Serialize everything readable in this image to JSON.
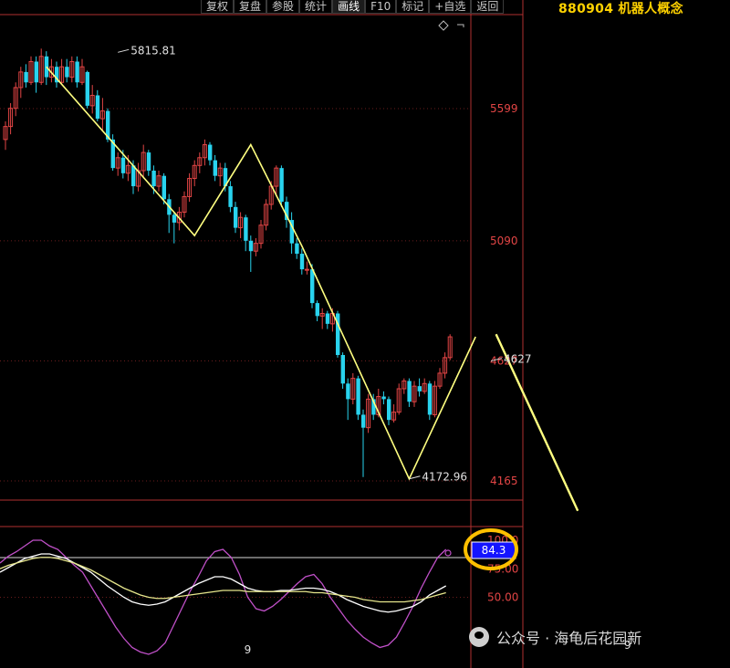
{
  "toolbar": {
    "items": [
      "复权",
      "复盘",
      "参股",
      "统计",
      "画线",
      "F10",
      "标记",
      "+自选",
      "返回"
    ],
    "active_index": 4
  },
  "instrument": {
    "title": "880904 机器人概念"
  },
  "watermark": {
    "text": "公众号 · 海龟后花园新"
  },
  "colors": {
    "background": "#000000",
    "up": "#e24545",
    "down": "#29d3ee",
    "trendline": "#ffff80",
    "axis": "#b03030",
    "price_label": "#e24545",
    "highlight": "#ffc000",
    "indicator_box": "#1414ff"
  },
  "chart_data": [
    {
      "type": "candlestick",
      "y_ticks": [
        5599,
        5090,
        4627,
        4165
      ],
      "ylim": [
        4065,
        5990
      ],
      "annotations": [
        {
          "text": "5815.81",
          "x": 22,
          "y": 5815.81
        },
        {
          "text": "4172.96",
          "x": 79,
          "y": 4172.96
        },
        {
          "text": "4627",
          "x": 95,
          "y": 4627
        }
      ],
      "last_price_marker": "4627",
      "candles": [
        [
          5480,
          5530,
          5440,
          5550
        ],
        [
          5530,
          5600,
          5500,
          5620
        ],
        [
          5600,
          5680,
          5570,
          5700
        ],
        [
          5680,
          5740,
          5640,
          5760
        ],
        [
          5740,
          5700,
          5680,
          5770
        ],
        [
          5700,
          5780,
          5690,
          5800
        ],
        [
          5780,
          5700,
          5660,
          5800
        ],
        [
          5700,
          5800,
          5690,
          5830
        ],
        [
          5800,
          5720,
          5690,
          5820
        ],
        [
          5720,
          5760,
          5700,
          5790
        ],
        [
          5760,
          5700,
          5680,
          5780
        ],
        [
          5700,
          5760,
          5690,
          5790
        ],
        [
          5760,
          5720,
          5700,
          5790
        ],
        [
          5720,
          5780,
          5700,
          5800
        ],
        [
          5780,
          5700,
          5680,
          5800
        ],
        [
          5700,
          5760,
          5690,
          5790
        ],
        [
          5740,
          5610,
          5600,
          5745
        ],
        [
          5610,
          5650,
          5580,
          5690
        ],
        [
          5650,
          5560,
          5550,
          5670
        ],
        [
          5560,
          5590,
          5510,
          5640
        ],
        [
          5590,
          5480,
          5470,
          5600
        ],
        [
          5480,
          5370,
          5360,
          5500
        ],
        [
          5370,
          5410,
          5340,
          5430
        ],
        [
          5410,
          5350,
          5330,
          5440
        ],
        [
          5350,
          5380,
          5320,
          5420
        ],
        [
          5380,
          5300,
          5270,
          5400
        ],
        [
          5300,
          5360,
          5280,
          5390
        ],
        [
          5360,
          5430,
          5330,
          5460
        ],
        [
          5430,
          5360,
          5340,
          5440
        ],
        [
          5360,
          5300,
          5270,
          5380
        ],
        [
          5300,
          5340,
          5280,
          5360
        ],
        [
          5340,
          5250,
          5230,
          5350
        ],
        [
          5250,
          5190,
          5120,
          5270
        ],
        [
          5190,
          5160,
          5080,
          5200
        ],
        [
          5160,
          5200,
          5130,
          5220
        ],
        [
          5200,
          5260,
          5180,
          5280
        ],
        [
          5260,
          5330,
          5240,
          5350
        ],
        [
          5330,
          5380,
          5300,
          5400
        ],
        [
          5380,
          5410,
          5350,
          5430
        ],
        [
          5410,
          5460,
          5380,
          5480
        ],
        [
          5460,
          5400,
          5380,
          5470
        ],
        [
          5400,
          5340,
          5320,
          5420
        ],
        [
          5340,
          5370,
          5300,
          5390
        ],
        [
          5370,
          5300,
          5280,
          5390
        ],
        [
          5300,
          5220,
          5200,
          5320
        ],
        [
          5220,
          5140,
          5120,
          5240
        ],
        [
          5140,
          5180,
          5100,
          5200
        ],
        [
          5180,
          5090,
          5050,
          5190
        ],
        [
          5090,
          5050,
          4970,
          5110
        ],
        [
          5050,
          5080,
          5030,
          5100
        ],
        [
          5080,
          5150,
          5060,
          5170
        ],
        [
          5150,
          5230,
          5130,
          5250
        ],
        [
          5230,
          5300,
          5210,
          5320
        ],
        [
          5300,
          5370,
          5260,
          5380
        ],
        [
          5370,
          5240,
          5220,
          5380
        ],
        [
          5240,
          5170,
          5140,
          5260
        ],
        [
          5170,
          5080,
          5040,
          5200
        ],
        [
          5080,
          5040,
          5020,
          5100
        ],
        [
          5040,
          4980,
          4960,
          5060
        ],
        [
          4980,
          4980,
          4960,
          5010
        ],
        [
          4980,
          4850,
          4830,
          5000
        ],
        [
          4850,
          4800,
          4780,
          4860
        ],
        [
          4800,
          4810,
          4750,
          4830
        ],
        [
          4810,
          4770,
          4750,
          4820
        ],
        [
          4770,
          4810,
          4740,
          4830
        ],
        [
          4810,
          4650,
          4640,
          4820
        ],
        [
          4650,
          4540,
          4520,
          4660
        ],
        [
          4540,
          4480,
          4400,
          4560
        ],
        [
          4480,
          4560,
          4460,
          4580
        ],
        [
          4560,
          4420,
          4400,
          4570
        ],
        [
          4420,
          4370,
          4180,
          4440
        ],
        [
          4370,
          4480,
          4350,
          4500
        ],
        [
          4480,
          4420,
          4400,
          4500
        ],
        [
          4420,
          4490,
          4410,
          4520
        ],
        [
          4490,
          4480,
          4460,
          4510
        ],
        [
          4480,
          4400,
          4380,
          4490
        ],
        [
          4400,
          4430,
          4390,
          4460
        ],
        [
          4430,
          4520,
          4420,
          4540
        ],
        [
          4520,
          4550,
          4500,
          4560
        ],
        [
          4550,
          4470,
          4450,
          4560
        ],
        [
          4470,
          4530,
          4450,
          4550
        ],
        [
          4530,
          4510,
          4490,
          4560
        ],
        [
          4510,
          4540,
          4500,
          4560
        ],
        [
          4540,
          4420,
          4400,
          4550
        ],
        [
          4420,
          4530,
          4410,
          4550
        ],
        [
          4530,
          4580,
          4520,
          4600
        ],
        [
          4580,
          4640,
          4560,
          4660
        ],
        [
          4640,
          4720,
          4630,
          4730
        ]
      ],
      "trendline": [
        {
          "x": 8,
          "y": 5760
        },
        {
          "x": 37,
          "y": 5110
        },
        {
          "x": 48,
          "y": 5460
        },
        {
          "x": 58,
          "y": 5070
        },
        {
          "x": 79,
          "y": 4172.96
        },
        {
          "x": 92,
          "y": 4720
        }
      ],
      "projection_line": [
        {
          "x": 96,
          "y": 4730
        },
        {
          "x": 112,
          "y": 4050
        }
      ]
    },
    {
      "type": "line",
      "y_ticks": [
        "100.0",
        "75.00",
        "50.00"
      ],
      "ylim": [
        0,
        110
      ],
      "current_value": "84.3",
      "labels": [
        {
          "text": "9",
          "x": 30,
          "y": 4
        },
        {
          "text": "9",
          "x": 76,
          "y": 8
        }
      ],
      "series": [
        {
          "color": "#c050c8",
          "values": [
            80,
            86,
            90,
            95,
            100,
            100,
            95,
            92,
            85,
            78,
            72,
            60,
            48,
            36,
            24,
            14,
            6,
            2,
            0,
            3,
            10,
            25,
            40,
            55,
            68,
            82,
            90,
            92,
            85,
            70,
            50,
            40,
            38,
            42,
            48,
            55,
            62,
            68,
            70,
            62,
            50,
            40,
            30,
            22,
            15,
            10,
            6,
            8,
            15,
            28,
            42,
            58,
            72,
            85,
            92
          ]
        },
        {
          "color": "#ffffff",
          "values": [
            72,
            76,
            80,
            84,
            86,
            88,
            88,
            86,
            84,
            80,
            76,
            72,
            66,
            60,
            55,
            50,
            46,
            44,
            43,
            44,
            46,
            50,
            54,
            58,
            62,
            65,
            68,
            68,
            66,
            62,
            58,
            56,
            55,
            55,
            56,
            56,
            57,
            58,
            58,
            57,
            55,
            52,
            48,
            45,
            42,
            40,
            38,
            37,
            38,
            40,
            42,
            46,
            52,
            56,
            60
          ]
        },
        {
          "color": "#e6e68c",
          "values": [
            75,
            78,
            80,
            82,
            84,
            85,
            85,
            84,
            82,
            80,
            77,
            74,
            70,
            66,
            62,
            58,
            55,
            52,
            50,
            49,
            49,
            50,
            51,
            52,
            53,
            54,
            55,
            56,
            56,
            56,
            55,
            55,
            55,
            55,
            55,
            55,
            55,
            55,
            54,
            54,
            53,
            52,
            51,
            50,
            48,
            47,
            46,
            46,
            46,
            46,
            47,
            48,
            50,
            52,
            54
          ]
        }
      ]
    }
  ]
}
